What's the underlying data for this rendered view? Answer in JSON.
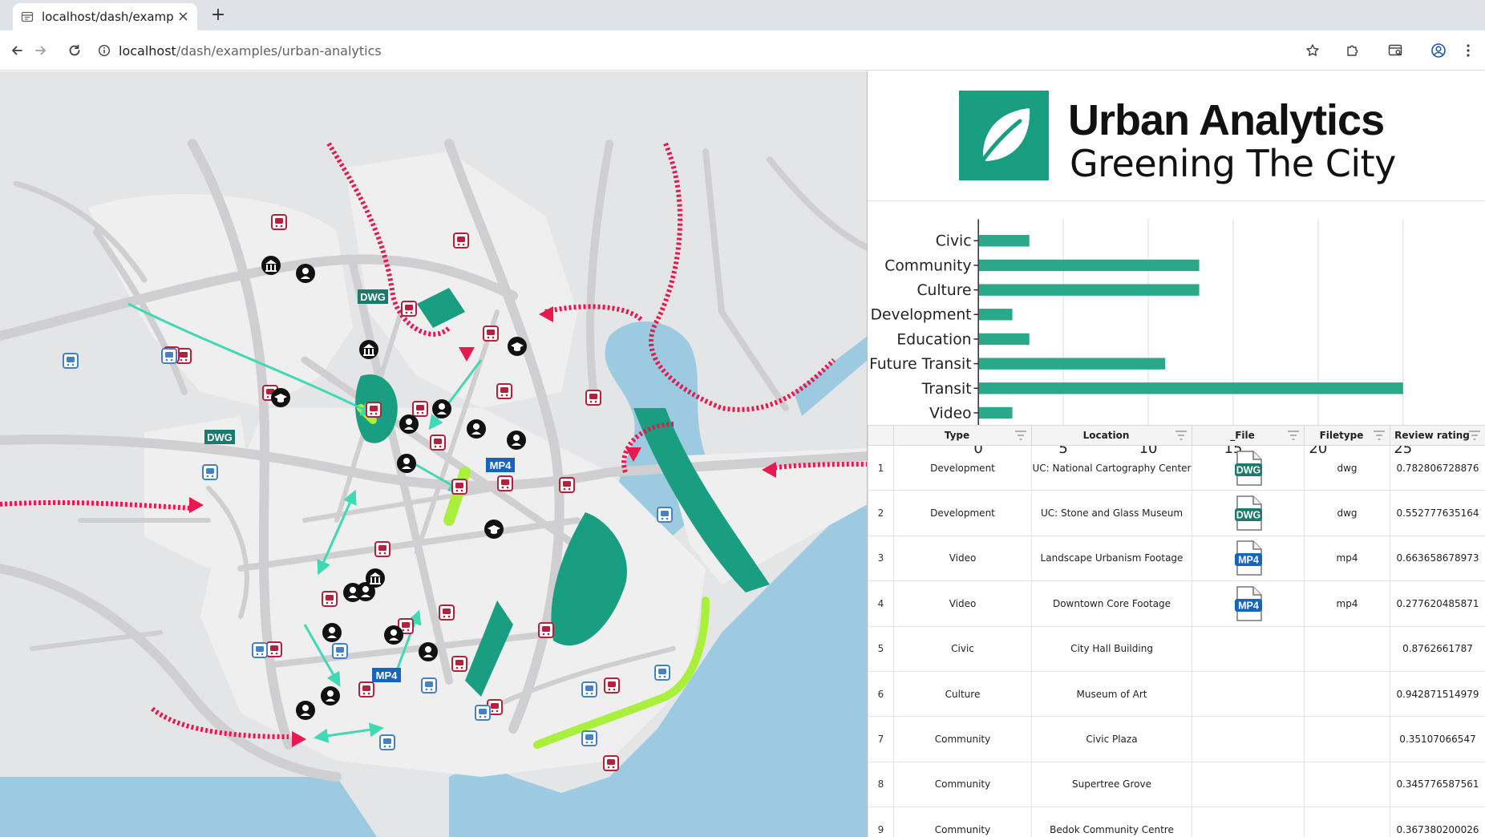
{
  "browser": {
    "tab_title": "localhost/dash/examples/urban-analytics",
    "tab_close": "×",
    "new_tab": "+",
    "url_host": "localhost",
    "url_path": "/dash/examples/urban-analytics"
  },
  "brand": {
    "title": "Urban Analytics",
    "subtitle": "Greening The City",
    "color": "#1a9e82"
  },
  "map": {
    "labels": [
      {
        "kind": "dwg",
        "text": "DWG"
      },
      {
        "kind": "dwg",
        "text": "DWG"
      },
      {
        "kind": "mp4",
        "text": "MP4"
      },
      {
        "kind": "mp4",
        "text": "MP4"
      }
    ],
    "colors": {
      "land": "#e4e5e7",
      "district": "#efeff0",
      "roads": "#cfcfd1",
      "water": "#9ccbe1",
      "park": "#1a9e82",
      "greenway": "#a8f03c",
      "transit": "#b3213d",
      "bus": "#4682c0",
      "arrow": "#e8194f"
    }
  },
  "chart_data": {
    "type": "bar",
    "orientation": "horizontal",
    "categories": [
      "Civic",
      "Community",
      "Culture",
      "Development",
      "Education",
      "Future Transit",
      "Transit",
      "Video"
    ],
    "values": [
      3,
      13,
      13,
      2,
      3,
      11,
      25,
      2
    ],
    "xlim": [
      0,
      25
    ],
    "xticks": [
      0,
      5,
      10,
      15,
      20,
      25
    ],
    "grid": true,
    "bar_color": "#2aa88a"
  },
  "table": {
    "columns": [
      "",
      "Type",
      "Location",
      "_File",
      "Filetype",
      "Review rating"
    ],
    "rows": [
      {
        "idx": "1",
        "type": "Development",
        "location": "UC: National Cartography Center",
        "file": "DWG",
        "filetype": "dwg",
        "rating": "0.782806728876"
      },
      {
        "idx": "2",
        "type": "Development",
        "location": "UC: Stone and Glass Museum",
        "file": "DWG",
        "filetype": "dwg",
        "rating": "0.552777635164"
      },
      {
        "idx": "3",
        "type": "Video",
        "location": "Landscape Urbanism Footage",
        "file": "MP4",
        "filetype": "mp4",
        "rating": "0.663658678973"
      },
      {
        "idx": "4",
        "type": "Video",
        "location": "Downtown Core Footage",
        "file": "MP4",
        "filetype": "mp4",
        "rating": "0.277620485871"
      },
      {
        "idx": "5",
        "type": "Civic",
        "location": "City Hall Building",
        "file": "",
        "filetype": "",
        "rating": "0.8762661787"
      },
      {
        "idx": "6",
        "type": "Culture",
        "location": "Museum of Art",
        "file": "",
        "filetype": "",
        "rating": "0.942871514979"
      },
      {
        "idx": "7",
        "type": "Community",
        "location": "Civic Plaza",
        "file": "",
        "filetype": "",
        "rating": "0.35107066547"
      },
      {
        "idx": "8",
        "type": "Community",
        "location": "Supertree Grove",
        "file": "",
        "filetype": "",
        "rating": "0.345776587561"
      },
      {
        "idx": "9",
        "type": "Community",
        "location": "Bedok Community Centre",
        "file": "",
        "filetype": "",
        "rating": "0.367380200026"
      }
    ],
    "file_colors": {
      "DWG": "#1a7a6d",
      "MP4": "#1565c0"
    }
  }
}
